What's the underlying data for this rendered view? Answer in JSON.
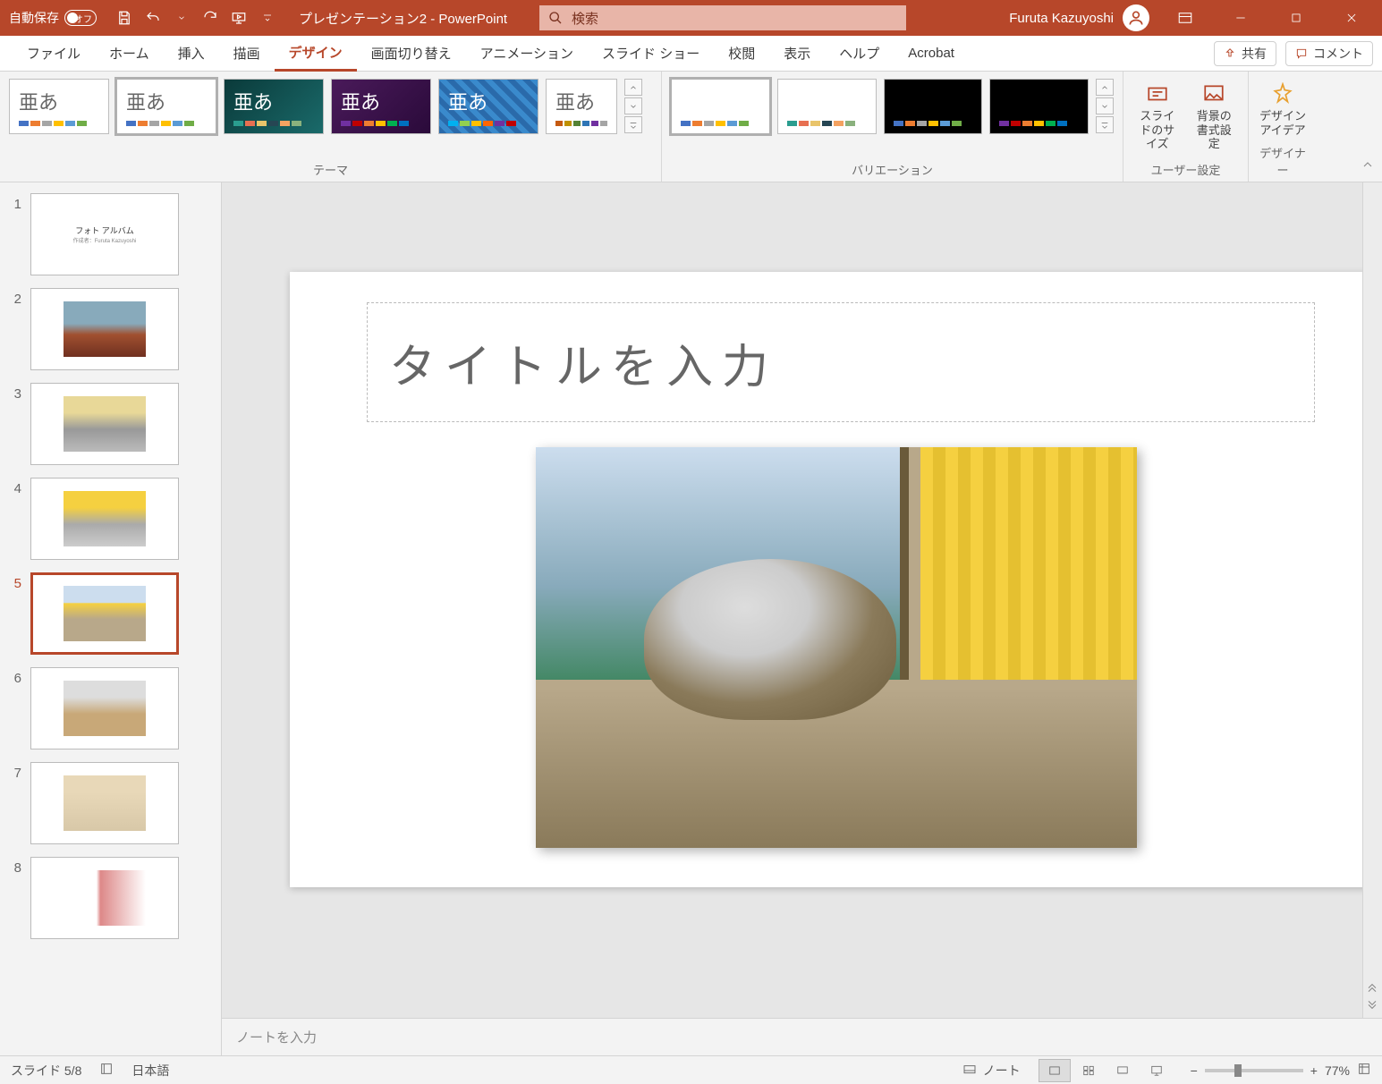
{
  "titlebar": {
    "autosave_label": "自動保存",
    "autosave_state": "オフ",
    "document_name": "プレゼンテーション2",
    "separator": " - ",
    "app_name": "PowerPoint",
    "search_placeholder": "検索",
    "user_name": "Furuta Kazuyoshi"
  },
  "tabs": {
    "file": "ファイル",
    "home": "ホーム",
    "insert": "挿入",
    "draw": "描画",
    "design": "デザイン",
    "transitions": "画面切り替え",
    "animations": "アニメーション",
    "slideshow": "スライド ショー",
    "review": "校閲",
    "view": "表示",
    "help": "ヘルプ",
    "acrobat": "Acrobat",
    "share": "共有",
    "comments": "コメント"
  },
  "ribbon": {
    "themes_label": "テーマ",
    "variations_label": "バリエーション",
    "user_settings_label": "ユーザー設定",
    "designer_label": "デザイナー",
    "theme_sample": "亜あ",
    "slide_size_label": "スライドのサイズ",
    "bg_format_label": "背景の書式設定",
    "design_ideas_label": "デザインアイデア"
  },
  "slides": {
    "count": 8,
    "selected": 5,
    "thumb_title": "フォト アルバム",
    "thumb_subtitle": "作成者：Furuta Kazuyoshi",
    "numbers": [
      "1",
      "2",
      "3",
      "4",
      "5",
      "6",
      "7",
      "8"
    ]
  },
  "slide": {
    "title_placeholder": "タイトルを入力"
  },
  "notes": {
    "placeholder": "ノートを入力"
  },
  "status": {
    "slide_counter": "スライド 5/8",
    "language": "日本語",
    "notes_btn": "ノート",
    "zoom_pct": "77%"
  }
}
